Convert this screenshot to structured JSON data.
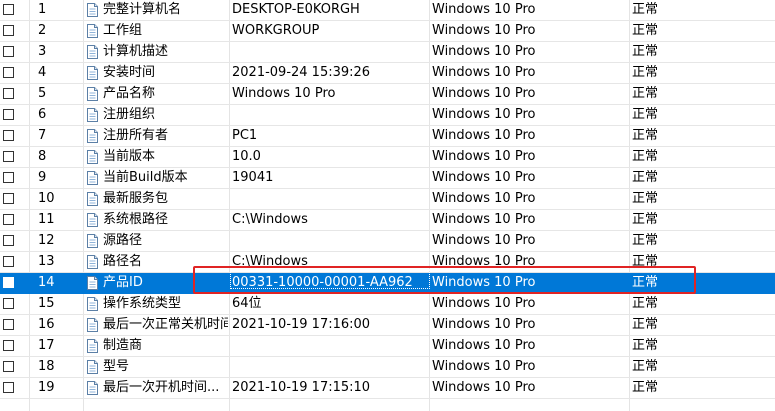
{
  "list": {
    "rows": [
      {
        "index": "1",
        "name": "完整计算机名",
        "value": "DESKTOP-E0KORGH",
        "os": "Windows 10 Pro",
        "status": "正常"
      },
      {
        "index": "2",
        "name": "工作组",
        "value": "WORKGROUP",
        "os": "Windows 10 Pro",
        "status": "正常"
      },
      {
        "index": "3",
        "name": "计算机描述",
        "value": "",
        "os": "Windows 10 Pro",
        "status": "正常"
      },
      {
        "index": "4",
        "name": "安装时间",
        "value": "2021-09-24 15:39:26",
        "os": "Windows 10 Pro",
        "status": "正常"
      },
      {
        "index": "5",
        "name": "产品名称",
        "value": "Windows 10 Pro",
        "os": "Windows 10 Pro",
        "status": "正常"
      },
      {
        "index": "6",
        "name": "注册组织",
        "value": "",
        "os": "Windows 10 Pro",
        "status": "正常"
      },
      {
        "index": "7",
        "name": "注册所有者",
        "value": "PC1",
        "os": "Windows 10 Pro",
        "status": "正常"
      },
      {
        "index": "8",
        "name": "当前版本",
        "value": "10.0",
        "os": "Windows 10 Pro",
        "status": "正常"
      },
      {
        "index": "9",
        "name": "当前Build版本",
        "value": "19041",
        "os": "Windows 10 Pro",
        "status": "正常"
      },
      {
        "index": "10",
        "name": "最新服务包",
        "value": "",
        "os": "Windows 10 Pro",
        "status": "正常"
      },
      {
        "index": "11",
        "name": "系统根路径",
        "value": "C:\\Windows",
        "os": "Windows 10 Pro",
        "status": "正常"
      },
      {
        "index": "12",
        "name": "源路径",
        "value": "",
        "os": "Windows 10 Pro",
        "status": "正常"
      },
      {
        "index": "13",
        "name": "路径名",
        "value": "C:\\Windows",
        "os": "Windows 10 Pro",
        "status": "正常"
      },
      {
        "index": "14",
        "name": "产品ID",
        "value": "00331-10000-00001-AA962",
        "os": "Windows 10 Pro",
        "status": "正常"
      },
      {
        "index": "15",
        "name": "操作系统类型",
        "value": "64位",
        "os": "Windows 10 Pro",
        "status": "正常"
      },
      {
        "index": "16",
        "name": "最后一次正常关机时间",
        "value": "2021-10-19 17:16:00",
        "os": "Windows 10 Pro",
        "status": "正常"
      },
      {
        "index": "17",
        "name": "制造商",
        "value": "",
        "os": "Windows 10 Pro",
        "status": "正常"
      },
      {
        "index": "18",
        "name": "型号",
        "value": "",
        "os": "Windows 10 Pro",
        "status": "正常"
      },
      {
        "index": "19",
        "name": "最后一次开机时间...",
        "value": "2021-10-19 17:15:10",
        "os": "Windows 10 Pro",
        "status": "正常"
      }
    ],
    "selected_index": 13
  },
  "icons": {
    "row_icon": "document-icon",
    "checkbox": "checkbox-icon"
  },
  "colors": {
    "selection": "#0078d7",
    "highlight_box": "#e02424"
  }
}
